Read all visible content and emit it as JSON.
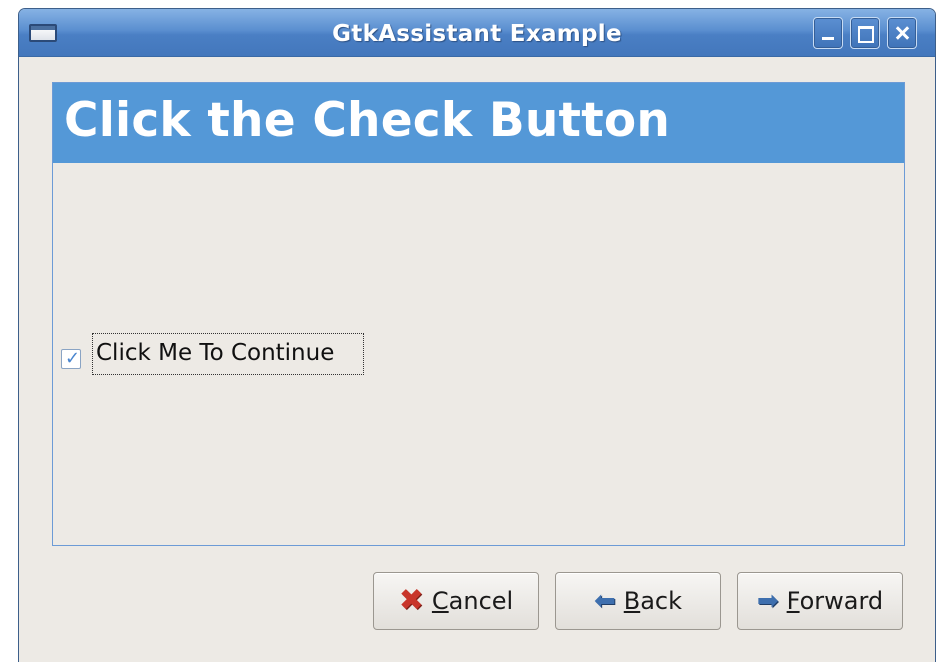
{
  "window": {
    "title": "GtkAssistant Example"
  },
  "page": {
    "title": "Click the Check Button"
  },
  "checkbox": {
    "label": "Click Me To Continue",
    "checked": true
  },
  "buttons": {
    "cancel": {
      "mnemonic": "C",
      "rest": "ancel",
      "icon": "cancel-icon"
    },
    "back": {
      "mnemonic": "B",
      "rest": "ack",
      "icon": "back-arrow-icon"
    },
    "forward": {
      "mnemonic": "F",
      "rest": "orward",
      "icon": "forward-arrow-icon"
    }
  },
  "colors": {
    "header": "#5498d7",
    "titlebar": "#4a7fc4",
    "background": "#edeae5"
  }
}
